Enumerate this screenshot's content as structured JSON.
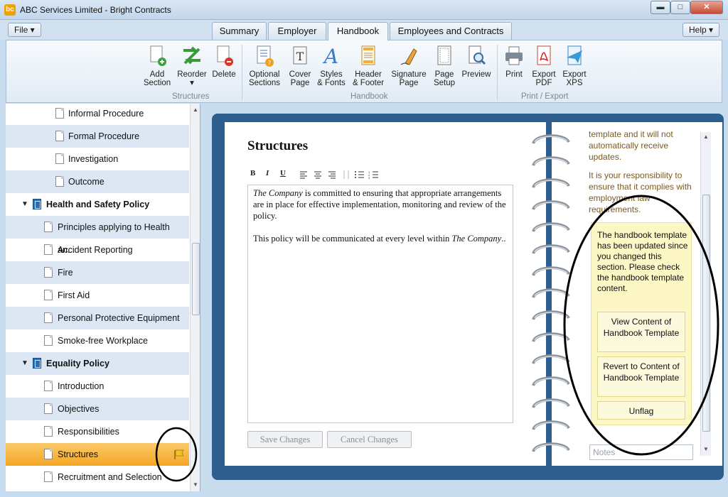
{
  "window": {
    "title": "ABC Services Limited - Bright Contracts",
    "app_icon": "bc",
    "minimize": "▬",
    "maximize": "□",
    "close": "✕"
  },
  "menu": {
    "file": "File ▾",
    "help": "Help ▾",
    "tabs": [
      "Summary",
      "Employer",
      "Handbook",
      "Employees and Contracts"
    ],
    "active_tab": "Handbook"
  },
  "ribbon": {
    "structures": {
      "group": "Structures",
      "add": [
        "Add",
        "Section"
      ],
      "reorder": [
        "Reorder",
        "▾"
      ],
      "delete": [
        "Delete"
      ]
    },
    "handbook": {
      "group": "Handbook",
      "optional": [
        "Optional",
        "Sections"
      ],
      "cover": [
        "Cover",
        "Page"
      ],
      "styles": [
        "Styles",
        "& Fonts"
      ],
      "header": [
        "Header",
        "& Footer"
      ],
      "signature": [
        "Signature",
        "Page"
      ],
      "setup": [
        "Page",
        "Setup"
      ],
      "preview": [
        "Preview"
      ]
    },
    "print": {
      "group": "Print / Export",
      "print": [
        "Print"
      ],
      "pdf": [
        "Export",
        "PDF"
      ],
      "xps": [
        "Export",
        "XPS"
      ]
    }
  },
  "tree": {
    "items": [
      {
        "label": "Informal Procedure",
        "level": 2
      },
      {
        "label": "Formal Procedure",
        "level": 2
      },
      {
        "label": "Investigation",
        "level": 2
      },
      {
        "label": "Outcome",
        "level": 2
      },
      {
        "label": "Health and Safety Policy",
        "level": 0
      },
      {
        "label": "Principles applying to Health an...",
        "level": 1
      },
      {
        "label": "Accident Reporting",
        "level": 1
      },
      {
        "label": "Fire",
        "level": 1
      },
      {
        "label": "First Aid",
        "level": 1
      },
      {
        "label": "Personal Protective Equipment",
        "level": 1
      },
      {
        "label": "Smoke-free Workplace",
        "level": 1
      },
      {
        "label": "Equality Policy",
        "level": 0
      },
      {
        "label": "Introduction",
        "level": 1
      },
      {
        "label": "Objectives",
        "level": 1
      },
      {
        "label": "Responsibilities",
        "level": 1
      },
      {
        "label": "Structures",
        "level": 1
      },
      {
        "label": "Recruitment and Selection",
        "level": 1
      }
    ],
    "selected": "Structures"
  },
  "editor": {
    "title": "Structures",
    "toolbar": [
      "B",
      "I",
      "U"
    ],
    "para1_em": "The Company",
    "para1_rest": " is committed to ensuring that appropriate arrangements are in place for effective implementation, monitoring and review of the policy.",
    "para2_start": "This policy will be communicated at every level within ",
    "para2_em": "The Company",
    "para2_end": "..",
    "save_label": "Save Changes",
    "cancel_label": "Cancel Changes"
  },
  "sidebar_note": {
    "text1": "template and it will not automatically receive updates.",
    "text2": "It is your responsibility to ensure that it complies with employment law requirements.",
    "notice": "The handbook template has been updated since you changed this section. Please check the handbook template content.",
    "view_btn": "View Content of Handbook Template",
    "revert_btn": "Revert to Content of Handbook Template",
    "unflag_btn": "Unflag",
    "notes_placeholder": "Notes"
  },
  "colors": {
    "selected_row": "#f5a623",
    "book_frame": "#2d5e8e",
    "notice_bg": "#fdf6c5"
  }
}
